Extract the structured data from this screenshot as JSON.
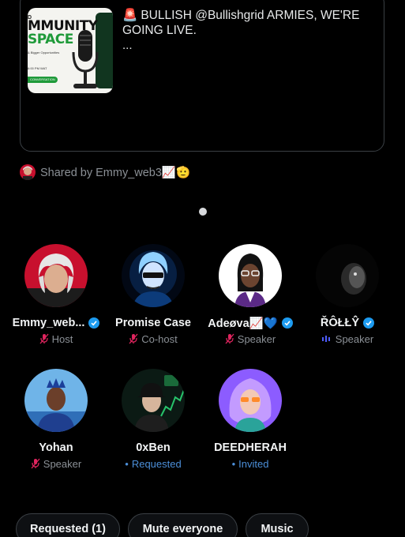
{
  "post": {
    "thumbnail": {
      "brand": "D",
      "headline_line1": "MMUNITY",
      "headline_line2": "SPACE",
      "subline": "& Bigger Opportunities",
      "time": "6:00 PM WAT",
      "pill": "CONVERSATION"
    },
    "siren_emoji": "🚨",
    "text": "BULLISH @Bullishgrid ARMIES, WE'RE GOING LIVE.",
    "ellipsis": "..."
  },
  "shared_by": {
    "text": "Shared by Emmy_web3📈🫡"
  },
  "participants": [
    {
      "name": "Emmy_web...",
      "verified": true,
      "role": "Host",
      "role_icon": "mic-off-icon"
    },
    {
      "name": "Promise Case",
      "verified": false,
      "role": "Co-host",
      "role_icon": "mic-off-icon"
    },
    {
      "name": "Adeøva📈💙",
      "verified": true,
      "role": "Speaker",
      "role_icon": "mic-off-icon"
    },
    {
      "name": "ŘÔŁŁŶ",
      "verified": true,
      "role": "Speaker",
      "role_icon": "speaking-bars-icon"
    },
    {
      "name": "Yohan",
      "verified": false,
      "role": "Speaker",
      "role_icon": "mic-off-icon"
    },
    {
      "name": "0xBen",
      "verified": false,
      "role": "Requested",
      "role_icon": "dot-icon"
    },
    {
      "name": "DEEDHERAH",
      "verified": false,
      "role": "Invited",
      "role_icon": "dot-icon"
    }
  ],
  "actions": {
    "requested_label": "Requested (1)",
    "mute_label": "Mute everyone",
    "music_label": "Music"
  },
  "colors": {
    "background": "#000000",
    "verified_blue": "#1d9bf0",
    "muted_red": "#e0245e",
    "secondary_text": "#8b9096",
    "status_blue": "#4c8fd9"
  }
}
